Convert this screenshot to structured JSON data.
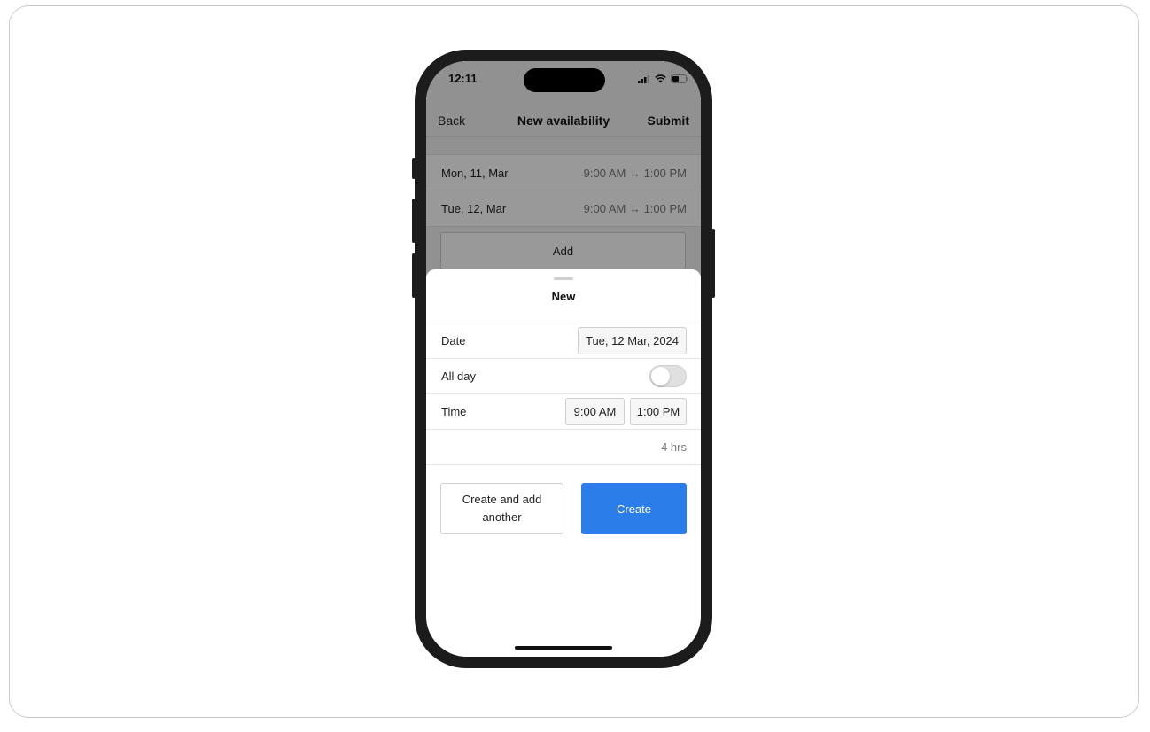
{
  "status_bar": {
    "time": "12:11"
  },
  "nav": {
    "back_label": "Back",
    "title": "New availability",
    "submit_label": "Submit"
  },
  "availability_list": [
    {
      "date": "Mon, 11, Mar",
      "time_range": "9:00 AM → 1:00 PM"
    },
    {
      "date": "Tue, 12, Mar",
      "time_range": "9:00 AM → 1:00 PM"
    }
  ],
  "add_button_label": "Add",
  "sheet": {
    "title": "New",
    "date_label": "Date",
    "date_value": "Tue, 12 Mar, 2024",
    "all_day_label": "All day",
    "all_day_enabled": false,
    "time_label": "Time",
    "start_time": "9:00 AM",
    "end_time": "1:00 PM",
    "duration": "4 hrs",
    "create_another_label": "Create and add another",
    "create_label": "Create"
  },
  "colors": {
    "primary": "#2b7de9",
    "overlay": "rgba(0,0,0,0.40)",
    "frame": "#1c1c1c"
  },
  "icons": [
    "cellular-signal-icon",
    "wifi-icon",
    "battery-icon"
  ]
}
